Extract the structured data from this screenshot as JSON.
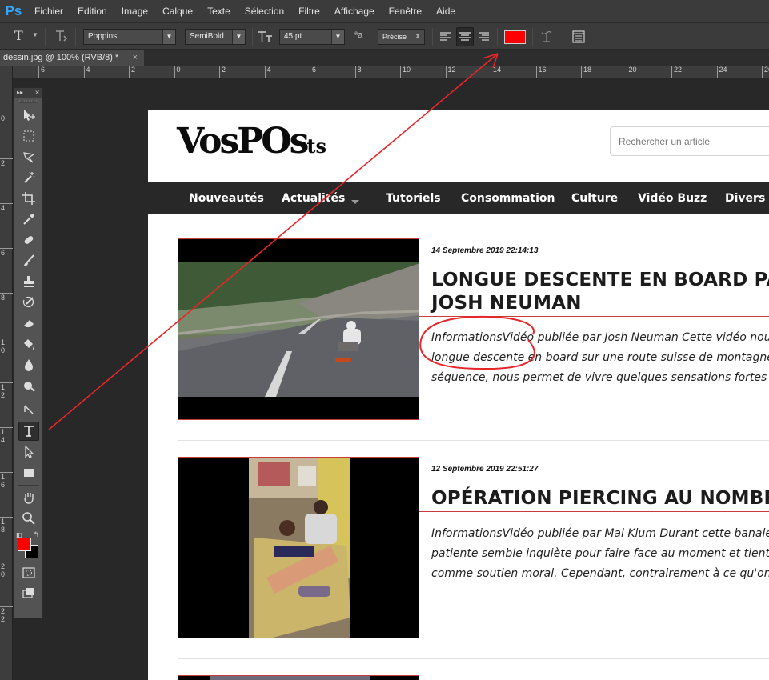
{
  "app": {
    "logo": "Ps",
    "menu": [
      "Fichier",
      "Edition",
      "Image",
      "Calque",
      "Texte",
      "Sélection",
      "Filtre",
      "Affichage",
      "Fenêtre",
      "Aide"
    ]
  },
  "options": {
    "tool_glyph": "T",
    "font_family": "Poppins",
    "font_style": "SemiBold",
    "font_size": "45 pt",
    "aa_glyph": "ªa",
    "antialias": "Précise",
    "text_color": "#ff0000"
  },
  "document": {
    "tab_label": "dessin.jpg @ 100% (RVB/8) *",
    "close": "×"
  },
  "ruler": {
    "h_labels": [
      "6",
      "4",
      "2",
      "0",
      "2",
      "4",
      "6",
      "8",
      "10",
      "12",
      "14",
      "16",
      "18",
      "20",
      "22",
      "24",
      "26"
    ],
    "v_labels": [
      "0",
      "2",
      "4",
      "6",
      "8",
      "10",
      "12",
      "14",
      "16",
      "18",
      "20",
      "22"
    ]
  },
  "toolbox": {
    "header": "▸▸",
    "close": "×",
    "foreground": "#ff0000",
    "background": "#000000"
  },
  "site": {
    "logo_main": "VosPOs",
    "logo_small": "ts",
    "search_placeholder": "Rechercher un article",
    "nav": [
      "Nouveautés",
      "Actualités",
      "Tutoriels",
      "Consommation",
      "Culture",
      "Vidéo Buzz",
      "Divers"
    ],
    "articles": [
      {
        "date": "14 Septembre 2019 22:14:13",
        "title_lines": [
          "LONGUE DESCENTE EN BOARD PAR JO",
          "JOSH NEUMAN"
        ],
        "excerpt_lines": [
          "InformationsVidéo publiée par Josh Neuman Cette vidéo nous pré",
          "longue descente en board sur une route suisse de montagne. Josh",
          "séquence, nous permet de vivre quelques sensations fortes derriè"
        ]
      },
      {
        "date": "12 Septembre 2019 22:51:27",
        "title_lines": [
          "OPÉRATION PIERCING AU NOMBRIL"
        ],
        "excerpt_lines": [
          "InformationsVidéo publiée par Mal Klum Durant cette banale proc",
          "patiente semble inquiète pour faire face au moment et tient la m",
          "comme soutien moral. Cependant, contrairement à ce qu'on..."
        ]
      }
    ]
  },
  "annotation": {
    "color": "#e8262a"
  }
}
